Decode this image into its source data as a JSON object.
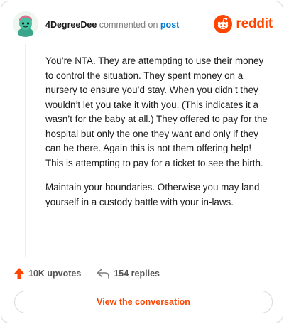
{
  "comment": {
    "username": "4DegreeDee",
    "action_text": "commented on",
    "post_link_label": "post",
    "paragraphs": [
      "You’re NTA. They are attempting to use their money to control the situation. They spent money on a nursery to ensure you’d stay. When you didn’t they wouldn’t let you take it with you. (This indicates it a wasn’t for the baby at all.) They offered to pay for the hospital but only the one they want and only if they can be there. Again this is not them offering help! This is attempting to pay for a ticket to see the birth.",
      "Maintain your boundaries. Otherwise you may land yourself in a custody battle with your in-laws."
    ],
    "upvotes_label": "10K upvotes",
    "replies_label": "154 replies"
  },
  "brand": {
    "name": "reddit",
    "icon": "reddit-logo-icon",
    "color": "#ff4500"
  },
  "footer": {
    "view_conversation_label": "View the conversation"
  },
  "colors": {
    "accent": "#ff4500",
    "link": "#0079d3",
    "muted": "#7c7c7c",
    "border": "#d7d9dc"
  }
}
